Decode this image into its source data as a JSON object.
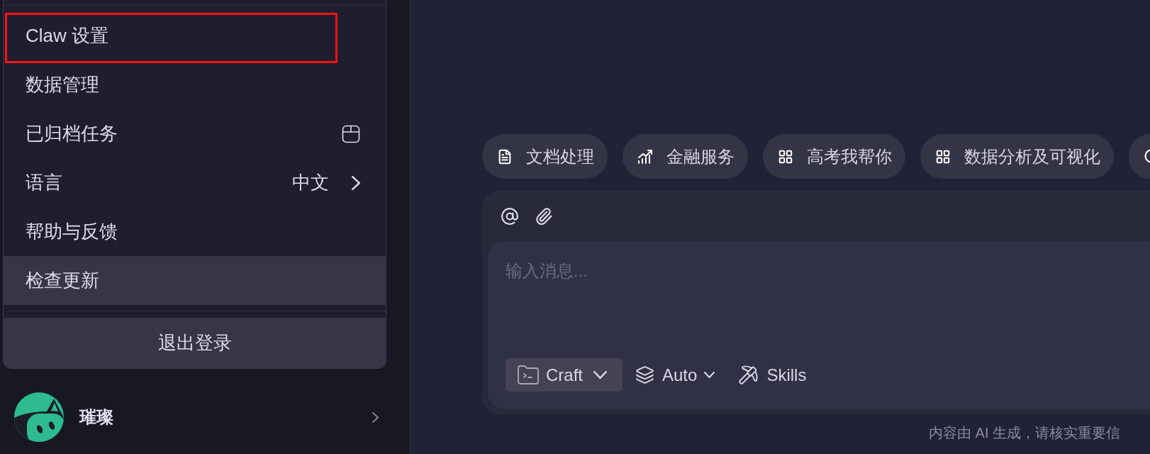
{
  "sidebar": {
    "menu": {
      "items": [
        {
          "label": "Claw 设置",
          "kind": "plain",
          "hovered": false,
          "annotated": true
        },
        {
          "label": "数据管理",
          "kind": "plain",
          "hovered": false,
          "annotated": false
        },
        {
          "label": "已归档任务",
          "kind": "archive",
          "hovered": false,
          "annotated": false
        },
        {
          "label": "语言",
          "kind": "submenu",
          "value": "中文",
          "hovered": false,
          "annotated": false
        },
        {
          "label": "帮助与反馈",
          "kind": "plain",
          "hovered": false,
          "annotated": false
        },
        {
          "label": "检查更新",
          "kind": "plain",
          "hovered": true,
          "annotated": false
        }
      ],
      "logout": "退出登录"
    },
    "user": {
      "name": "璀璨"
    }
  },
  "main": {
    "suggestions": [
      {
        "label": "文档处理",
        "kind": "document"
      },
      {
        "label": "金融服务",
        "kind": "chart"
      },
      {
        "label": "高考我帮你",
        "kind": "grid"
      },
      {
        "label": "数据分析及可视化",
        "kind": "grid"
      },
      {
        "kind": "search"
      }
    ],
    "composer": {
      "placeholder": "输入消息...",
      "mode": "Craft",
      "model": "Auto",
      "skills": "Skills"
    },
    "disclaimer": "内容由 AI 生成，请核实重要信"
  }
}
